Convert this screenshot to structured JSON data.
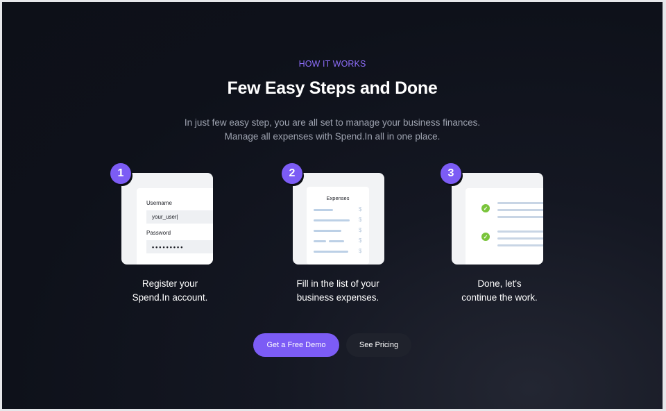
{
  "section": {
    "eyebrow": "HOW IT WORKS",
    "title": "Few Easy Steps and Done",
    "subtitle_line1": "In just few easy step, you are all set to manage your business finances.",
    "subtitle_line2": "Manage all expenses with Spend.In all in one place."
  },
  "steps": [
    {
      "number": "1",
      "label_line1": "Register your",
      "label_line2": "Spend.In account.",
      "card": {
        "username_label": "Username",
        "username_value": "your_user|",
        "password_label": "Password",
        "password_value": "•••••••••"
      }
    },
    {
      "number": "2",
      "label_line1": "Fill in the list of your",
      "label_line2": "business expenses.",
      "card": {
        "title": "Expenses",
        "currency": "$"
      }
    },
    {
      "number": "3",
      "label_line1": "Done, let's",
      "label_line2": "continue the work.",
      "card": {
        "check_icon": "check-icon"
      }
    }
  ],
  "buttons": {
    "demo_label": "Get a Free Demo",
    "pricing_label": "See Pricing"
  },
  "colors": {
    "accent": "#7c5cf5",
    "background": "#0e111a",
    "success": "#7ac43b"
  }
}
